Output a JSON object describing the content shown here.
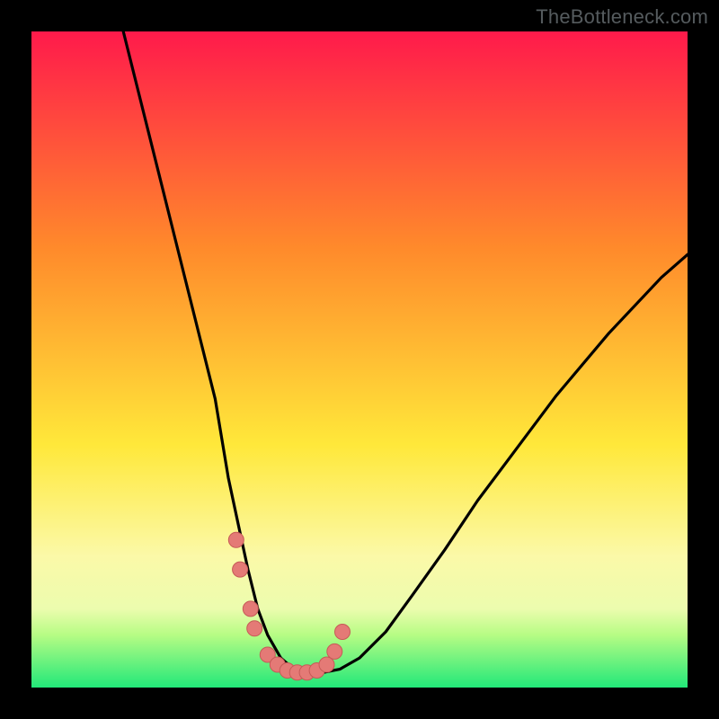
{
  "watermark": "TheBottleneck.com",
  "colors": {
    "frame": "#000000",
    "top": "#ff1a4b",
    "orange": "#ff8a2b",
    "yellow": "#ffe83a",
    "pale_yellow": "#fbf9a8",
    "light_green": "#b6fc84",
    "green": "#22e879",
    "curve": "#000000",
    "marker_fill": "#e47a76",
    "marker_stroke": "#c65a57"
  },
  "chart_data": {
    "type": "line",
    "title": "",
    "xlabel": "",
    "ylabel": "",
    "xlim": [
      0,
      100
    ],
    "ylim": [
      0,
      100
    ],
    "series": [
      {
        "name": "bottleneck-curve",
        "x_pct": [
          14,
          16,
          18,
          20,
          22,
          24,
          26,
          28,
          29,
          30,
          31.5,
          33,
          34.5,
          36,
          38,
          40,
          42,
          44,
          47,
          50,
          54,
          58,
          63,
          68,
          74,
          80,
          88,
          96,
          100
        ],
        "y_pct": [
          100,
          92,
          84,
          76,
          68,
          60,
          52,
          44,
          38,
          32,
          25,
          18,
          12,
          8,
          4.5,
          2.8,
          2.2,
          2.2,
          2.8,
          4.5,
          8.5,
          14,
          21,
          28.5,
          36.5,
          44.5,
          54,
          62.5,
          66
        ]
      }
    ],
    "markers": {
      "x_pct": [
        31.2,
        31.8,
        33.4,
        34.0,
        36.0,
        37.5,
        39.0,
        40.5,
        42.0,
        43.5,
        45.0,
        46.2,
        47.4
      ],
      "y_pct": [
        22.5,
        18.0,
        12.0,
        9.0,
        5.0,
        3.5,
        2.6,
        2.3,
        2.3,
        2.6,
        3.5,
        5.5,
        8.5
      ]
    },
    "gradient_stops_pct": [
      {
        "p": 0,
        "c": "#ff1a4b"
      },
      {
        "p": 33,
        "c": "#ff8a2b"
      },
      {
        "p": 63,
        "c": "#ffe83a"
      },
      {
        "p": 80,
        "c": "#fbf9a8"
      },
      {
        "p": 88,
        "c": "#ecfcae"
      },
      {
        "p": 92,
        "c": "#b6fc84"
      },
      {
        "p": 100,
        "c": "#22e879"
      }
    ]
  }
}
